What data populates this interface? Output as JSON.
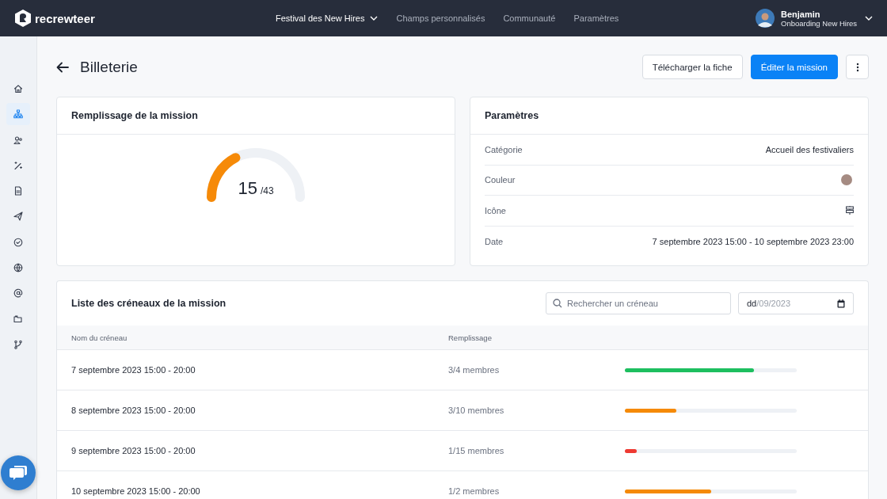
{
  "topbar": {
    "logo": "recrewteer",
    "nav": [
      {
        "label": "Festival des New Hires",
        "selected": true,
        "dropdown": true
      },
      {
        "label": "Champs personnalisés",
        "selected": false,
        "dropdown": false
      },
      {
        "label": "Communauté",
        "selected": false,
        "dropdown": false
      },
      {
        "label": "Paramètres",
        "selected": false,
        "dropdown": false
      }
    ],
    "user": {
      "name": "Benjamin",
      "org": "Onboarding New Hires"
    }
  },
  "sidebar": {
    "items": [
      {
        "selected": false
      },
      {
        "selected": true
      },
      {
        "selected": false
      },
      {
        "selected": false
      },
      {
        "selected": false
      },
      {
        "selected": false
      },
      {
        "selected": false
      },
      {
        "selected": false
      },
      {
        "selected": false
      },
      {
        "selected": false
      },
      {
        "selected": false
      }
    ]
  },
  "page": {
    "title": "Billeterie",
    "buttons": [
      {
        "label": "Télécharger la fiche",
        "kind": "secondary"
      },
      {
        "label": "Éditer la mission",
        "kind": "primary"
      }
    ]
  },
  "fill_card": {
    "title": "Remplissage de la mission",
    "value": "15",
    "total": "/43"
  },
  "settings_card": {
    "title": "Paramètres",
    "rows": [
      {
        "label": "Catégorie",
        "kind": "text",
        "value": "Accueil des festivaliers"
      },
      {
        "label": "Couleur",
        "kind": "color",
        "color": "#a58b82"
      },
      {
        "label": "Icône",
        "kind": "icon"
      },
      {
        "label": "Date",
        "kind": "text",
        "value": "7 septembre 2023 15:00 - 10 septembre 2023 23:00"
      }
    ]
  },
  "slots": {
    "title": "Liste des créneaux de la mission",
    "search": {
      "placeholder": "Rechercher un créneau"
    },
    "date": {
      "day": "dd",
      "rest": "/09/2023"
    },
    "columns": [
      "Nom du créneau",
      "Remplissage"
    ],
    "rows": [
      {
        "name": "7 septembre 2023 15:00 - 20:00",
        "fill": "3/4 membres",
        "level": 0.75,
        "color": "#1dbf5f"
      },
      {
        "name": "8 septembre 2023 15:00 - 20:00",
        "fill": "3/10 membres",
        "level": 0.3,
        "color": "#f58a07"
      },
      {
        "name": "9 septembre 2023 15:00 - 20:00",
        "fill": "1/15 membres",
        "level": 0.067,
        "color": "#ee3a32"
      },
      {
        "name": "10 septembre 2023 15:00 - 20:00",
        "fill": "1/2 membres",
        "level": 0.5,
        "color": "#f58a07"
      }
    ]
  }
}
